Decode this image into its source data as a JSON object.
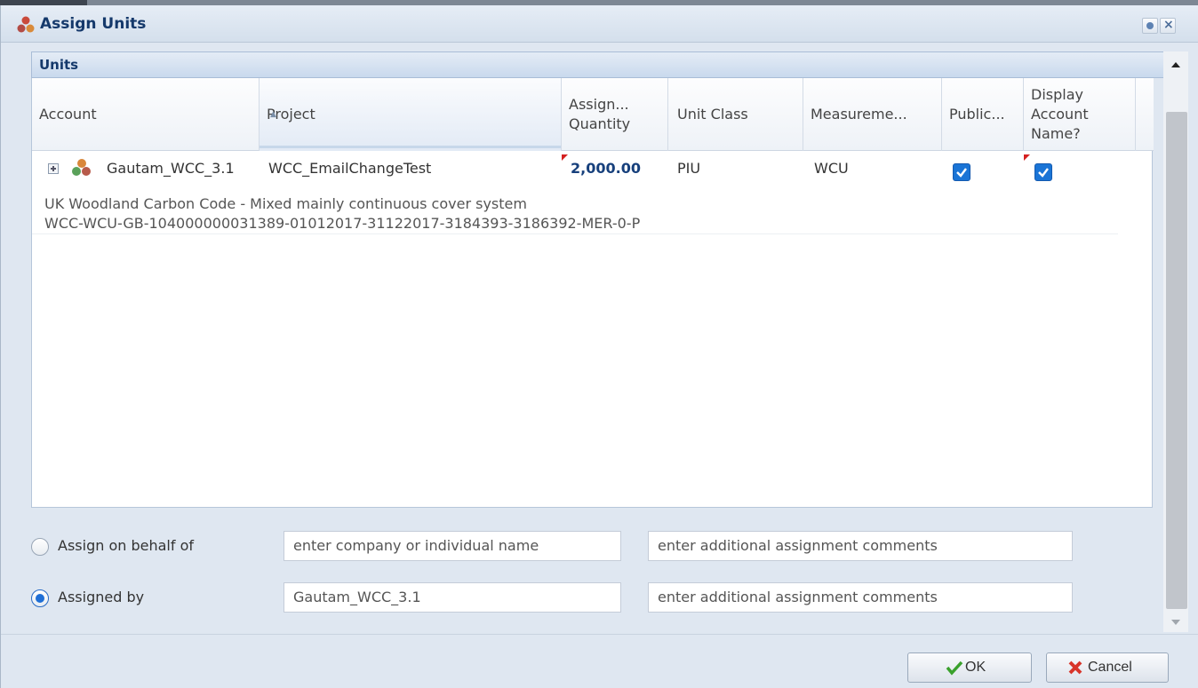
{
  "window": {
    "title": "Assign Units"
  },
  "panel": {
    "title": "Units"
  },
  "grid": {
    "columns": {
      "account": "Account",
      "project": "Project",
      "assign_quantity_1": "Assign...",
      "assign_quantity_2": "Quantity",
      "unit_class": "Unit Class",
      "measurement": "Measureme...",
      "public": "Public...",
      "display_1": "Display",
      "display_2": "Account",
      "display_3": "Name?"
    },
    "row": {
      "account": "Gautam_WCC_3.1",
      "project": "WCC_EmailChangeTest",
      "quantity": "2,000.00",
      "unit_class": "PIU",
      "measurement": "WCU",
      "public_checked": true,
      "display_account_name_checked": true,
      "description": "UK Woodland Carbon Code - Mixed mainly continuous cover system",
      "serial": "WCC-WCU-GB-104000000031389-01012017-31122017-3184393-3186392-MER-0-P"
    }
  },
  "form": {
    "assign_on_behalf": {
      "label": "Assign on behalf of",
      "selected": false,
      "name_placeholder": "enter company or individual name",
      "comments_placeholder": "enter additional assignment comments"
    },
    "assigned_by": {
      "label": "Assigned by",
      "selected": true,
      "name_value": "Gautam_WCC_3.1",
      "comments_placeholder": "enter additional assignment comments"
    }
  },
  "footer": {
    "ok_label": "OK",
    "cancel_label": "Cancel"
  },
  "colors": {
    "title_text": "#15396b",
    "quantity_text": "#17407c",
    "checkbox": "#1a74d6",
    "ok_icon": "#3aa12c",
    "cancel_icon": "#d8342a"
  }
}
